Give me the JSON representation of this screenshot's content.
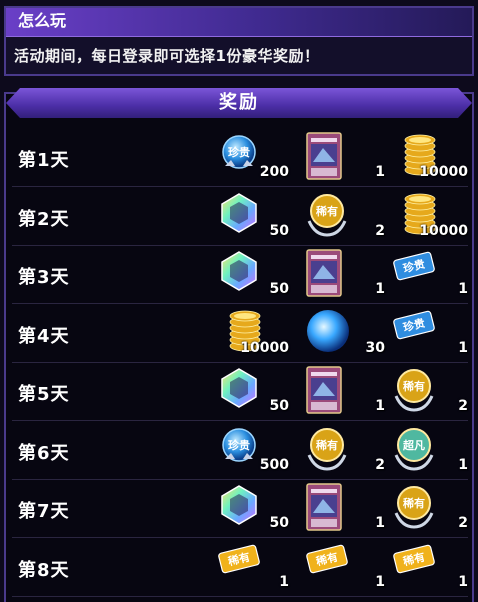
{
  "how_to_play": {
    "title": "怎么玩",
    "description": "活动期间，每日登录即可选择1份豪华奖励！"
  },
  "rewards": {
    "title": "奖励",
    "days": [
      {
        "label": "第1天",
        "items": [
          {
            "type": "orb-precious",
            "qty": "200"
          },
          {
            "type": "card",
            "qty": "1"
          },
          {
            "type": "gold-coins",
            "qty": "10000"
          }
        ]
      },
      {
        "label": "第2天",
        "items": [
          {
            "type": "gem",
            "qty": "50"
          },
          {
            "type": "medal-rare",
            "qty": "2"
          },
          {
            "type": "gold-coins",
            "qty": "10000"
          }
        ]
      },
      {
        "label": "第3天",
        "items": [
          {
            "type": "gem",
            "qty": "50"
          },
          {
            "type": "card",
            "qty": "1"
          },
          {
            "type": "ticket-precious",
            "qty": "1"
          }
        ]
      },
      {
        "label": "第4天",
        "items": [
          {
            "type": "gold-coins",
            "qty": "10000"
          },
          {
            "type": "blue-orb",
            "qty": "30"
          },
          {
            "type": "ticket-precious",
            "qty": "1"
          }
        ]
      },
      {
        "label": "第5天",
        "items": [
          {
            "type": "gem",
            "qty": "50"
          },
          {
            "type": "card",
            "qty": "1"
          },
          {
            "type": "medal-rare",
            "qty": "2"
          }
        ]
      },
      {
        "label": "第6天",
        "items": [
          {
            "type": "orb-precious",
            "qty": "500"
          },
          {
            "type": "medal-rare",
            "qty": "2"
          },
          {
            "type": "medal-super",
            "qty": "1"
          }
        ]
      },
      {
        "label": "第7天",
        "items": [
          {
            "type": "gem",
            "qty": "50"
          },
          {
            "type": "card",
            "qty": "1"
          },
          {
            "type": "medal-rare",
            "qty": "2"
          }
        ]
      },
      {
        "label": "第8天",
        "items": [
          {
            "type": "ticket-rare",
            "qty": "1"
          },
          {
            "type": "ticket-rare",
            "qty": "1"
          },
          {
            "type": "ticket-rare",
            "qty": "1"
          }
        ]
      }
    ]
  },
  "badge_text": {
    "precious": "珍贵",
    "rare": "稀有",
    "super": "超凡"
  },
  "colors": {
    "header_purple": "#6a3fc7",
    "gold": "#f2c12e",
    "ticket_blue": "#2f8de0",
    "ticket_gold": "#f0b21c"
  }
}
